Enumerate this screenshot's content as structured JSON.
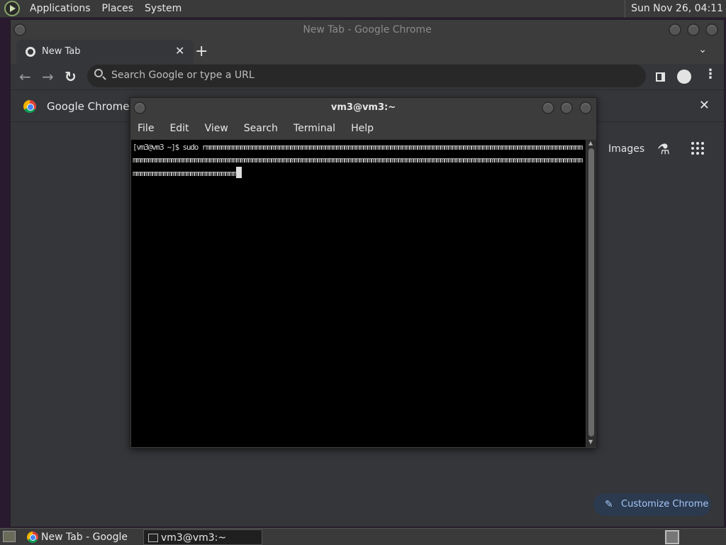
{
  "top_panel": {
    "menu": [
      "Applications",
      "Places",
      "System"
    ],
    "clock": "Sun Nov 26, 04:11"
  },
  "chrome": {
    "window_title": "New Tab - Google Chrome",
    "tab": {
      "title": "New Tab",
      "close": "✕"
    },
    "new_tab": "+",
    "tab_search": "⌄",
    "omnibox_placeholder": "Search Google or type a URL",
    "infobar_text": "Google Chrome isn",
    "infobar_close": "✕",
    "images_link": "Images",
    "customize_label": "Customize Chrome"
  },
  "terminal": {
    "window_title": "vm3@vm3:~",
    "menu": [
      "File",
      "Edit",
      "View",
      "Search",
      "Terminal",
      "Help"
    ],
    "prompt": "[vm3@vm3 ~]$ ",
    "command": "sudo rmmmmmmmmmmmmmmmmmmmmmmmmmmmmmmmmmmmmmmmmmmmmmmmmmmmmmmmmmmmmmmmmmmmmmmmmmmmmmmmmmmmmmmmmmmmmmmmmmmmmmmmmmmmmmmmmmmmmmmmmmmmmmmmmmmmmmmmmmmmmmmmmmmmmmmmmmmmmmmmmmmmmmmmmmmmmmmmmmmmmmmmmmmmmmmmmmmmmmmmmmmmmmmmmmmmmmmmmmmmmmmmmmmmmmmmmmmmmmmmmmm"
  },
  "taskbar": {
    "tasks": [
      "New Tab - Google ...",
      "vm3@vm3:~"
    ]
  },
  "colors": {
    "customize_bg": "#2b3a4e",
    "customize_text": "#a8c7fa",
    "terminal_bg": "#000000"
  }
}
